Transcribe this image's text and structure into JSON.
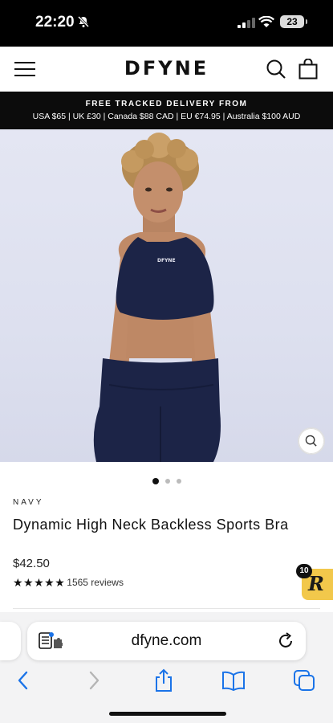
{
  "status_bar": {
    "time": "22:20",
    "battery": "23"
  },
  "header": {
    "logo": "DFYNE"
  },
  "banner": {
    "line1": "FREE TRACKED DELIVERY FROM",
    "line2": "USA $65 | UK £30 | Canada $88 CAD | EU €74.95 | Australia $100 AUD"
  },
  "carousel": {
    "total_images": 3,
    "active_index": 0
  },
  "product": {
    "color": "NAVY",
    "title": "Dynamic High Neck Backless Sports Bra",
    "price": "$42.50",
    "rating": 5,
    "stars": "★★★★★",
    "reviews": "1565 reviews"
  },
  "rewards": {
    "badge_count": "10",
    "letter": "R"
  },
  "browser": {
    "url": "dfyne.com"
  },
  "icons": {
    "menu": "menu-icon",
    "search": "search-icon",
    "bag": "shopping-bag-icon",
    "zoom": "zoom-icon",
    "reader": "reader-icon",
    "reload": "reload-icon",
    "back": "back-icon",
    "forward": "forward-icon",
    "share": "share-icon",
    "bookmarks": "bookmarks-icon",
    "tabs": "tabs-icon"
  },
  "colors": {
    "navy": "#1c2447",
    "banner_bg": "#0c0c0c",
    "rewards": "#f2c84b",
    "ios_blue": "#1a73e8"
  }
}
